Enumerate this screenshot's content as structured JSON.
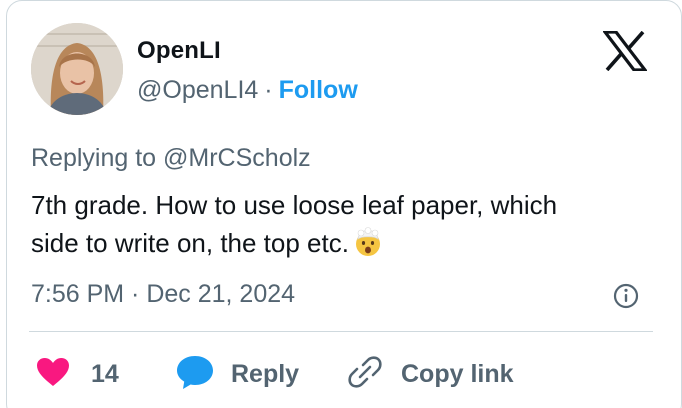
{
  "author": {
    "display_name": "OpenLI",
    "handle": "@OpenLI4",
    "separator": "·",
    "follow_label": "Follow"
  },
  "brand_icon": "x-logo-icon",
  "replying": {
    "prefix": "Replying to",
    "mention": "@MrCScholz"
  },
  "tweet": {
    "line1": "7th grade. How to use loose leaf paper, which",
    "line2": "side to write on, the top etc.",
    "emoji": "exploding-head-emoji"
  },
  "timestamp": "7:56 PM · Dec 21, 2024",
  "actions": {
    "like_count": "14",
    "reply_label": "Reply",
    "copy_label": "Copy link"
  },
  "colors": {
    "accent": "#1d9bf0",
    "like": "#f91880",
    "muted": "#536471",
    "text": "#0f1419",
    "border": "#cfd9de"
  }
}
